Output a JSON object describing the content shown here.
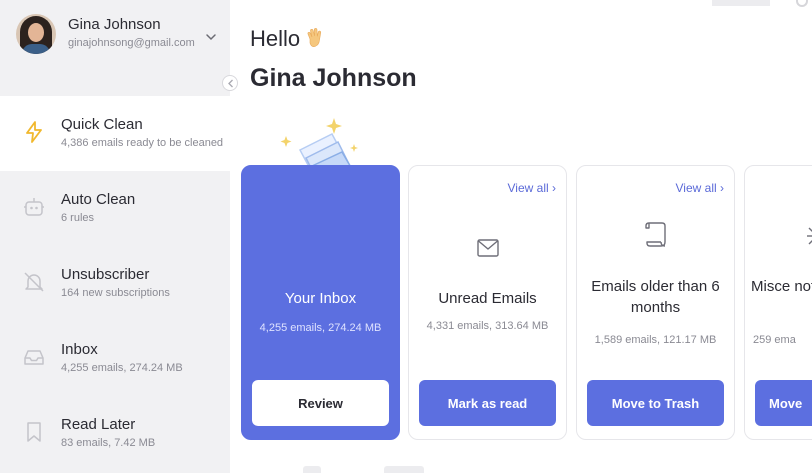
{
  "account": {
    "name": "Gina Johnson",
    "email": "ginajohnsong@gmail.com"
  },
  "sidebar": {
    "items": [
      {
        "title": "Quick Clean",
        "subtitle": "4,386 emails ready to be cleaned",
        "icon": "lightning-icon",
        "active": true
      },
      {
        "title": "Auto Clean",
        "subtitle": "6 rules",
        "icon": "robot-icon",
        "active": false
      },
      {
        "title": "Unsubscriber",
        "subtitle": "164 new subscriptions",
        "icon": "bell-off-icon",
        "active": false
      },
      {
        "title": "Inbox",
        "subtitle": "4,255 emails, 274.24 MB",
        "icon": "inbox-tray-icon",
        "active": false
      },
      {
        "title": "Read Later",
        "subtitle": "83 emails, 7.42 MB",
        "icon": "bookmark-icon",
        "active": false
      }
    ]
  },
  "main": {
    "greeting": "Hello",
    "user_title": "Gina Johnson"
  },
  "cards": [
    {
      "title": "Your Inbox",
      "meta": "4,255 emails, 274.24 MB",
      "button": "Review",
      "link": "",
      "icon": "inbox-illustration"
    },
    {
      "title": "Unread Emails",
      "meta": "4,331 emails, 313.64 MB",
      "button": "Mark as read",
      "link": "View all",
      "icon": "envelope-icon"
    },
    {
      "title": "Emails older than 6 months",
      "meta": "1,589 emails, 121.17 MB",
      "button": "Move to Trash",
      "link": "View all",
      "icon": "scroll-icon"
    },
    {
      "title": "Misce notifi",
      "meta": "259 ema",
      "button": "Move",
      "link": "",
      "icon": "sparkle-icon"
    }
  ],
  "colors": {
    "accent": "#5c6fe0",
    "sidebar_bg": "#f1f1f3",
    "link": "#5b6ad8",
    "lightning": "#f1b82d"
  }
}
